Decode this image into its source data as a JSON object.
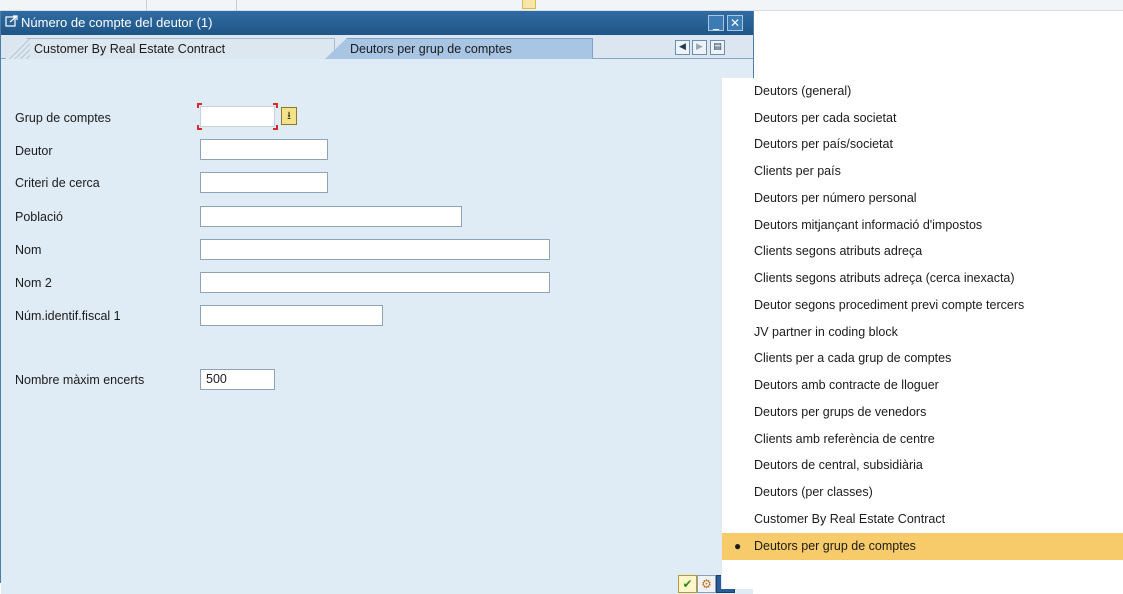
{
  "dialog": {
    "title": "Número de compte del deutor (1)",
    "controls": {
      "minimize": "_",
      "close": "✕"
    }
  },
  "tabs": [
    {
      "label": "Customer By Real Estate Contract",
      "active": false
    },
    {
      "label": "Deutors per grup de comptes",
      "active": true
    }
  ],
  "tab_nav": {
    "prev": "◀",
    "next": "▶",
    "list": "▤"
  },
  "form": {
    "grup_de_comptes": {
      "label": "Grup de comptes",
      "value": ""
    },
    "deutor": {
      "label": "Deutor",
      "value": ""
    },
    "criteri_de_cerca": {
      "label": "Criteri de cerca",
      "value": ""
    },
    "poblacio": {
      "label": "Població",
      "value": ""
    },
    "nom": {
      "label": "Nom",
      "value": ""
    },
    "nom_2": {
      "label": "Nom 2",
      "value": ""
    },
    "num_identif_fiscal": {
      "label": "Núm.identif.fiscal 1",
      "value": ""
    },
    "nombre_maxim": {
      "label": "Nombre màxim encerts",
      "value": "500"
    }
  },
  "dropdown_button_glyph": "⭳",
  "footer": {
    "ok": "✔",
    "gear": "⚙",
    "cancel": "✖"
  },
  "menu": {
    "items": [
      "Deutors (general)",
      "Deutors per cada societat",
      "Deutors per país/societat",
      "Clients per país",
      "Deutors per número personal",
      "Deutors mitjançant informació d'impostos",
      "Clients segons atributs adreça",
      "Clients segons atributs adreça (cerca inexacta)",
      "Deutor segons procediment previ compte tercers",
      "JV partner in coding block",
      "Clients per a cada grup de comptes",
      "Deutors amb contracte de lloguer",
      "Deutors per grups de venedors",
      "Clients amb referència de centre",
      "Deutors de central, subsidiària",
      "Deutors (per classes)",
      "Customer By Real Estate Contract",
      "Deutors per grup de comptes"
    ],
    "selected_index": 17,
    "selected_marker": "●"
  },
  "colors": {
    "title_bar": "#1f5586",
    "form_bg": "#dfebf5",
    "active_tab": "#a9c5e4",
    "menu_selected": "#f8cb6a",
    "required_marker": "#d62b2b"
  }
}
